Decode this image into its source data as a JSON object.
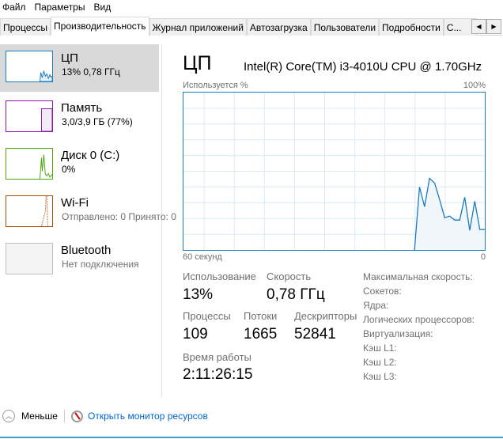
{
  "menu": [
    "Файл",
    "Параметры",
    "Вид"
  ],
  "tabs": [
    "Процессы",
    "Производительность",
    "Журнал приложений",
    "Автозагрузка",
    "Пользователи",
    "Подробности",
    "С..."
  ],
  "active_tab": 1,
  "sidebar": [
    {
      "name": "ЦП",
      "sub": "13%  0,78 ГГц",
      "color": "#1a7bc1",
      "selected": true
    },
    {
      "name": "Память",
      "sub": "3,0/3,9 ГБ (77%)",
      "color": "#8b12ae"
    },
    {
      "name": "Диск 0 (C:)",
      "sub": "0%",
      "color": "#4da60c"
    },
    {
      "name": "Wi-Fi",
      "sub": "Отправлено: 0 Принято: 0",
      "sub_bold": "0",
      "color": "#a74f01"
    },
    {
      "name": "Bluetooth",
      "sub": "Нет подключения",
      "color": "#c0c0c0"
    }
  ],
  "header": {
    "title": "ЦП",
    "model": "Intel(R) Core(TM) i3-4010U CPU @ 1.70GHz"
  },
  "graph": {
    "ylabel": "Используется %",
    "ymax_label": "100%",
    "xlabel_left": "60 секунд",
    "xlabel_right": "0",
    "color": "#1a7bc1",
    "usage_last_15s": [
      0,
      40,
      27.5,
      45.5,
      42.5,
      32,
      20.5,
      21.5,
      19,
      19,
      33.5,
      12.5,
      31,
      13,
      13
    ]
  },
  "stats": {
    "usage_label": "Использование",
    "usage": "13%",
    "speed_label": "Скорость",
    "speed": "0,78 ГГц",
    "processes_label": "Процессы",
    "processes": "109",
    "threads_label": "Потоки",
    "threads": "1665",
    "handles_label": "Дескрипторы",
    "handles": "52841",
    "uptime_label": "Время работы",
    "uptime": "2:11:26:15"
  },
  "info": [
    "Максимальная скорость:",
    "Сокетов:",
    "Ядра:",
    "Логических процессоров:",
    "Виртуализация:",
    "Кэш L1:",
    "Кэш L2:",
    "Кэш L3:"
  ],
  "footer": {
    "less": "Меньше",
    "monitor": "Открыть монитор ресурсов"
  }
}
